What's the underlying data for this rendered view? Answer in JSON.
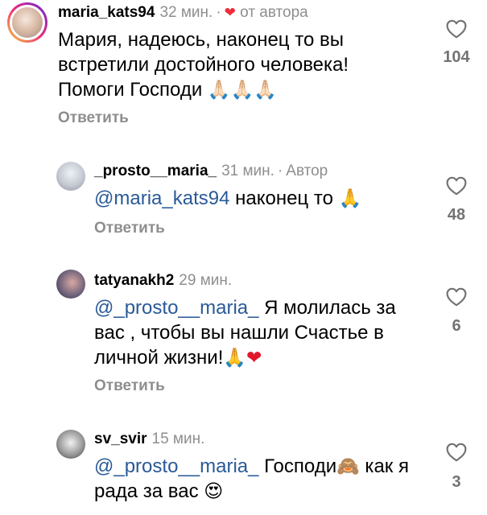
{
  "comments": [
    {
      "username": "maria_kats94",
      "time": "32 мин.",
      "dot": "·",
      "author_heart": "❤",
      "author_note": "от автора",
      "text_lines": [
        "Мария, надеюсь, наконец то вы",
        "встретили достойного человека!",
        "Помоги Господи"
      ],
      "emoji": "🙏🏻🙏🏻🙏🏻",
      "reply_label": "Ответить",
      "likes": "104",
      "story_ring": true
    },
    {
      "username": "_prosto__maria_",
      "time": "31 мин.",
      "dot": "·",
      "author_note": "Автор",
      "mention": "@maria_kats94",
      "text": "наконец то",
      "emoji": "🙏",
      "reply_label": "Ответить",
      "likes": "48"
    },
    {
      "username": "tatyanakh2",
      "time": "29 мин.",
      "mention": "@_prosto__maria_",
      "text_lines": [
        "Я молилась за",
        "вас , чтобы вы нашли Счастье в",
        "личной жизни!"
      ],
      "emoji": "🙏",
      "heart": "❤",
      "reply_label": "Ответить",
      "likes": "6"
    },
    {
      "username": "sv_svir",
      "time": "15 мин.",
      "mention": "@_prosto__maria_",
      "text_lines": [
        "Господи",
        "как я",
        "рада за вас"
      ],
      "emoji_monkey": "🙈",
      "emoji_eyes": "😍",
      "likes": "3"
    }
  ],
  "icons": {
    "like": "heart-outline-icon"
  },
  "colors": {
    "mention": "#2a5a97",
    "secondary": "#8e8e8e",
    "heart": "#ed2c3a"
  }
}
